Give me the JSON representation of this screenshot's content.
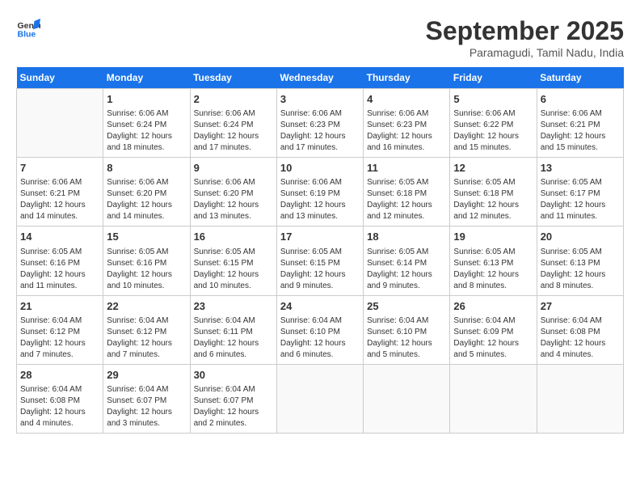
{
  "header": {
    "logo_line1": "General",
    "logo_line2": "Blue",
    "month": "September 2025",
    "location": "Paramagudi, Tamil Nadu, India"
  },
  "days_of_week": [
    "Sunday",
    "Monday",
    "Tuesday",
    "Wednesday",
    "Thursday",
    "Friday",
    "Saturday"
  ],
  "weeks": [
    [
      {
        "day": "",
        "info": ""
      },
      {
        "day": "1",
        "info": "Sunrise: 6:06 AM\nSunset: 6:24 PM\nDaylight: 12 hours\nand 18 minutes."
      },
      {
        "day": "2",
        "info": "Sunrise: 6:06 AM\nSunset: 6:24 PM\nDaylight: 12 hours\nand 17 minutes."
      },
      {
        "day": "3",
        "info": "Sunrise: 6:06 AM\nSunset: 6:23 PM\nDaylight: 12 hours\nand 17 minutes."
      },
      {
        "day": "4",
        "info": "Sunrise: 6:06 AM\nSunset: 6:23 PM\nDaylight: 12 hours\nand 16 minutes."
      },
      {
        "day": "5",
        "info": "Sunrise: 6:06 AM\nSunset: 6:22 PM\nDaylight: 12 hours\nand 15 minutes."
      },
      {
        "day": "6",
        "info": "Sunrise: 6:06 AM\nSunset: 6:21 PM\nDaylight: 12 hours\nand 15 minutes."
      }
    ],
    [
      {
        "day": "7",
        "info": "Sunrise: 6:06 AM\nSunset: 6:21 PM\nDaylight: 12 hours\nand 14 minutes."
      },
      {
        "day": "8",
        "info": "Sunrise: 6:06 AM\nSunset: 6:20 PM\nDaylight: 12 hours\nand 14 minutes."
      },
      {
        "day": "9",
        "info": "Sunrise: 6:06 AM\nSunset: 6:20 PM\nDaylight: 12 hours\nand 13 minutes."
      },
      {
        "day": "10",
        "info": "Sunrise: 6:06 AM\nSunset: 6:19 PM\nDaylight: 12 hours\nand 13 minutes."
      },
      {
        "day": "11",
        "info": "Sunrise: 6:05 AM\nSunset: 6:18 PM\nDaylight: 12 hours\nand 12 minutes."
      },
      {
        "day": "12",
        "info": "Sunrise: 6:05 AM\nSunset: 6:18 PM\nDaylight: 12 hours\nand 12 minutes."
      },
      {
        "day": "13",
        "info": "Sunrise: 6:05 AM\nSunset: 6:17 PM\nDaylight: 12 hours\nand 11 minutes."
      }
    ],
    [
      {
        "day": "14",
        "info": "Sunrise: 6:05 AM\nSunset: 6:16 PM\nDaylight: 12 hours\nand 11 minutes."
      },
      {
        "day": "15",
        "info": "Sunrise: 6:05 AM\nSunset: 6:16 PM\nDaylight: 12 hours\nand 10 minutes."
      },
      {
        "day": "16",
        "info": "Sunrise: 6:05 AM\nSunset: 6:15 PM\nDaylight: 12 hours\nand 10 minutes."
      },
      {
        "day": "17",
        "info": "Sunrise: 6:05 AM\nSunset: 6:15 PM\nDaylight: 12 hours\nand 9 minutes."
      },
      {
        "day": "18",
        "info": "Sunrise: 6:05 AM\nSunset: 6:14 PM\nDaylight: 12 hours\nand 9 minutes."
      },
      {
        "day": "19",
        "info": "Sunrise: 6:05 AM\nSunset: 6:13 PM\nDaylight: 12 hours\nand 8 minutes."
      },
      {
        "day": "20",
        "info": "Sunrise: 6:05 AM\nSunset: 6:13 PM\nDaylight: 12 hours\nand 8 minutes."
      }
    ],
    [
      {
        "day": "21",
        "info": "Sunrise: 6:04 AM\nSunset: 6:12 PM\nDaylight: 12 hours\nand 7 minutes."
      },
      {
        "day": "22",
        "info": "Sunrise: 6:04 AM\nSunset: 6:12 PM\nDaylight: 12 hours\nand 7 minutes."
      },
      {
        "day": "23",
        "info": "Sunrise: 6:04 AM\nSunset: 6:11 PM\nDaylight: 12 hours\nand 6 minutes."
      },
      {
        "day": "24",
        "info": "Sunrise: 6:04 AM\nSunset: 6:10 PM\nDaylight: 12 hours\nand 6 minutes."
      },
      {
        "day": "25",
        "info": "Sunrise: 6:04 AM\nSunset: 6:10 PM\nDaylight: 12 hours\nand 5 minutes."
      },
      {
        "day": "26",
        "info": "Sunrise: 6:04 AM\nSunset: 6:09 PM\nDaylight: 12 hours\nand 5 minutes."
      },
      {
        "day": "27",
        "info": "Sunrise: 6:04 AM\nSunset: 6:08 PM\nDaylight: 12 hours\nand 4 minutes."
      }
    ],
    [
      {
        "day": "28",
        "info": "Sunrise: 6:04 AM\nSunset: 6:08 PM\nDaylight: 12 hours\nand 4 minutes."
      },
      {
        "day": "29",
        "info": "Sunrise: 6:04 AM\nSunset: 6:07 PM\nDaylight: 12 hours\nand 3 minutes."
      },
      {
        "day": "30",
        "info": "Sunrise: 6:04 AM\nSunset: 6:07 PM\nDaylight: 12 hours\nand 2 minutes."
      },
      {
        "day": "",
        "info": ""
      },
      {
        "day": "",
        "info": ""
      },
      {
        "day": "",
        "info": ""
      },
      {
        "day": "",
        "info": ""
      }
    ]
  ]
}
